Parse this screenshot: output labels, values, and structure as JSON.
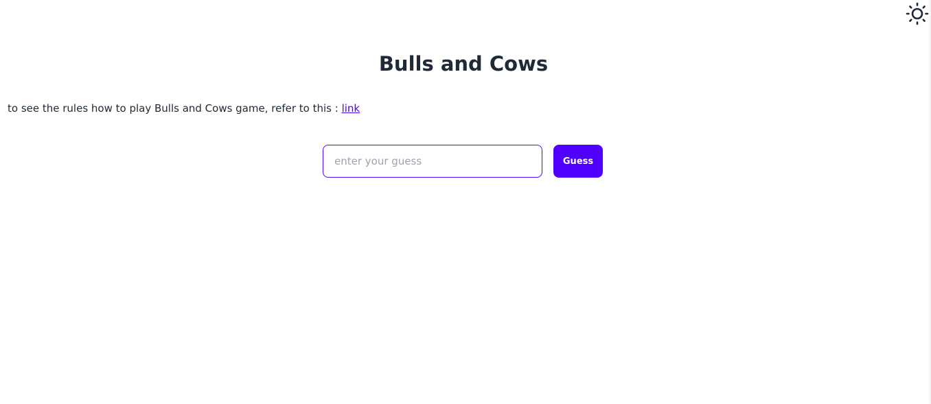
{
  "header": {
    "theme_toggle_icon": "sun-icon"
  },
  "main": {
    "title": "Bulls and Cows",
    "rules_text": "to see the rules how to play Bulls and Cows game, refer to this : ",
    "rules_link_label": "link"
  },
  "guess_form": {
    "input_value": "",
    "input_placeholder": "enter your guess",
    "button_label": "Guess"
  },
  "colors": {
    "accent": "#4f00ff",
    "text": "#1f2937",
    "placeholder": "#9ca3af",
    "background": "#ffffff"
  }
}
